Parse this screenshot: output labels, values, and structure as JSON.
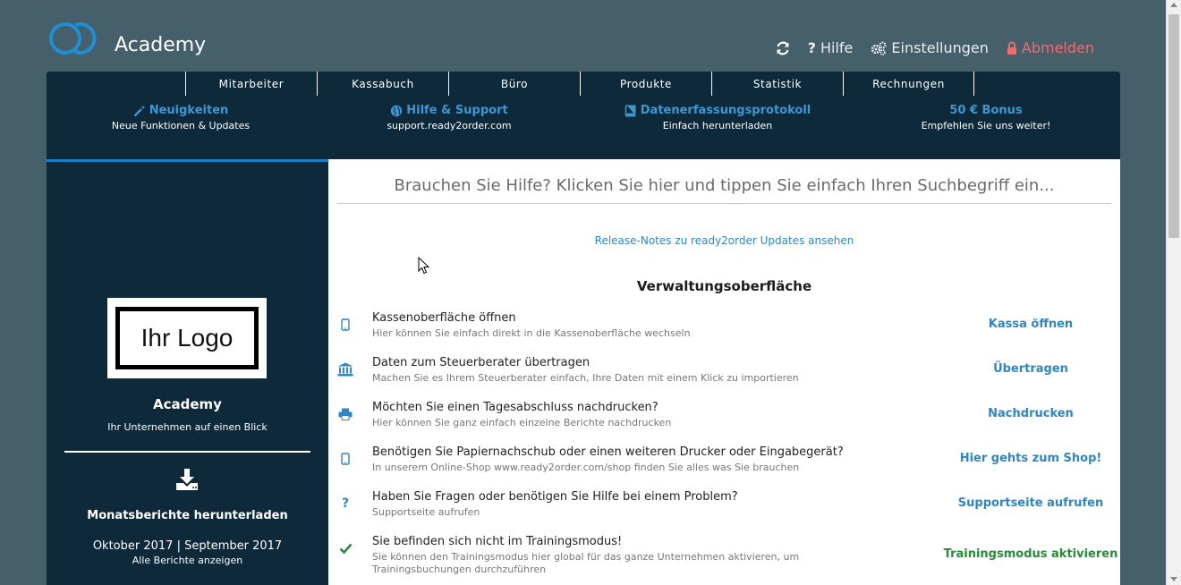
{
  "header": {
    "app_title": "Academy",
    "nav": {
      "refresh_icon": "refresh-icon",
      "help_label": "Hilfe",
      "settings_label": "Einstellungen",
      "logout_label": "Abmelden"
    }
  },
  "menu": {
    "tabs": [
      {
        "label": "Mitarbeiter"
      },
      {
        "label": "Kassabuch"
      },
      {
        "label": "Büro"
      },
      {
        "label": "Produkte"
      },
      {
        "label": "Statistik"
      },
      {
        "label": "Rechnungen"
      }
    ],
    "links": [
      {
        "title": "Neuigkeiten",
        "sub": "Neue Funktionen & Updates",
        "icon": "magic-wand-icon"
      },
      {
        "title": "Hilfe & Support",
        "sub": "support.ready2order.com",
        "icon": "globe-icon"
      },
      {
        "title": "Datenerfassungsprotokoll",
        "sub": "Einfach herunterladen",
        "icon": "book-icon"
      },
      {
        "title": "50 € Bonus",
        "sub": "Empfehlen Sie uns weiter!",
        "icon": ""
      }
    ]
  },
  "sidebar": {
    "logo_text": "Ihr Logo",
    "company_name": "Academy",
    "company_sub": "Ihr Unternehmen auf einen Blick",
    "reports_title": "Monatsberichte herunterladen",
    "reports_months": "Oktober 2017 | September 2017",
    "reports_all": "Alle Berichte anzeigen"
  },
  "main": {
    "search_placeholder": "Brauchen Sie Hilfe? Klicken Sie hier und tippen Sie einfach Ihren Suchbegriff ein...",
    "release_link": "Release-Notes zu ready2order Updates ansehen",
    "section_title": "Verwaltungsoberfläche",
    "actions": [
      {
        "icon": "tablet-icon",
        "title": "Kassenoberfläche öffnen",
        "desc": "Hier können Sie einfach direkt in die Kassenoberfläche wechseln",
        "button": "Kassa öffnen"
      },
      {
        "icon": "bank-icon",
        "title": "Daten zum Steuerberater übertragen",
        "desc": "Machen Sie es Ihrem Steuerberater einfach, Ihre Daten mit einem Klick zu importieren",
        "button": "Übertragen"
      },
      {
        "icon": "printer-icon",
        "title": "Möchten Sie einen Tagesabschluss nachdrucken?",
        "desc": "Hier können Sie ganz einfach einzelne Berichte nachdrucken",
        "button": "Nachdrucken"
      },
      {
        "icon": "tablet-icon",
        "title": "Benötigen Sie Papiernachschub oder einen weiteren Drucker oder Eingabegerät?",
        "desc": "In unserem Online-Shop www.ready2order.com/shop finden Sie alles was Sie brauchen",
        "button": "Hier gehts zum Shop!"
      },
      {
        "icon": "question-icon",
        "title": "Haben Sie Fragen oder benötigen Sie Hilfe bei einem Problem?",
        "desc": "Supportseite aufrufen",
        "button": "Supportseite aufrufen"
      },
      {
        "icon": "check-icon",
        "title": "Sie befinden sich nicht im Trainingsmodus!",
        "desc": "Sie können den Trainingsmodus hier global für das ganze Unternehmen aktivieren, um Trainingsbuchungen durchzuführen",
        "button": "Trainingsmodus aktivieren"
      }
    ]
  },
  "colors": {
    "background": "#45606b",
    "panel": "#0e2939",
    "accent": "#2f86c2",
    "green": "#2a8a3a",
    "logout": "#f36b6b"
  }
}
